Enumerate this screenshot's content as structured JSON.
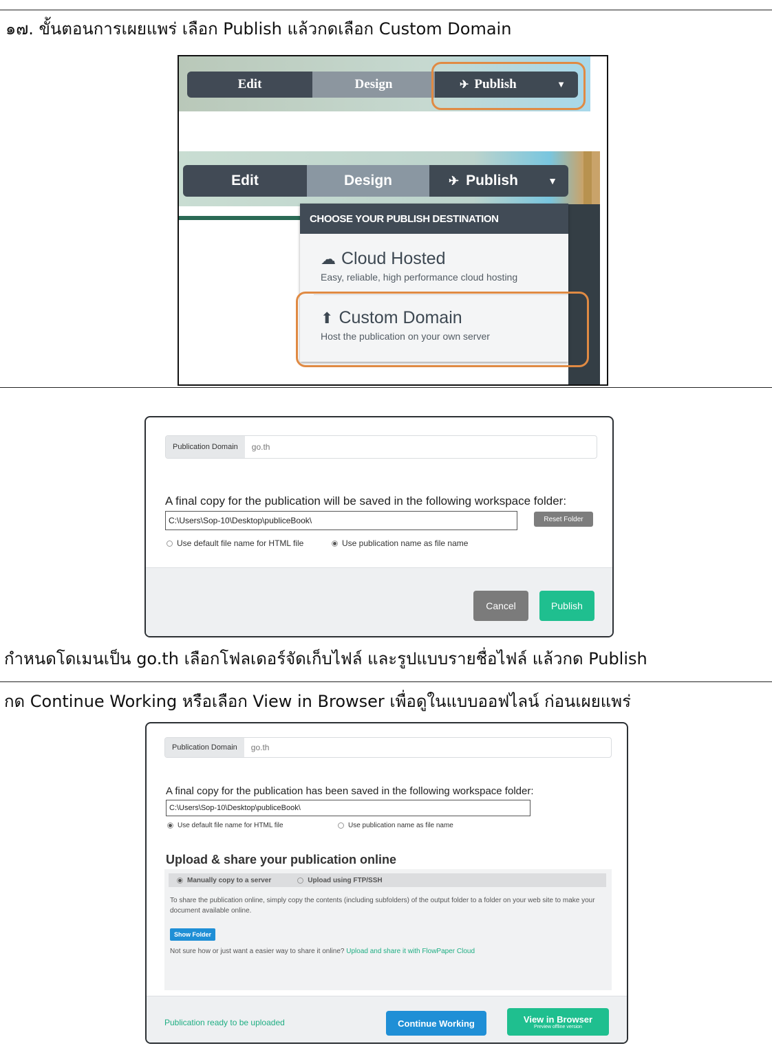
{
  "step17": {
    "heading": "๑๗. ขั้นตอนการเผยแพร่  เลือก Publish แล้วกดเลือก Custom Domain"
  },
  "menu_top": {
    "edit": "Edit",
    "design": "Design",
    "publish": "Publish"
  },
  "menu_bottom": {
    "edit": "Edit",
    "design": "Design",
    "publish": "Publish",
    "dropdown_header": "CHOOSE YOUR PUBLISH DESTINATION",
    "options": [
      {
        "title": "Cloud Hosted",
        "subtitle": "Easy, reliable, high performance cloud hosting",
        "icon": "cloud-icon"
      },
      {
        "title": "Custom Domain",
        "subtitle": "Host the publication on your own server",
        "icon": "upload-icon"
      }
    ]
  },
  "dialog1": {
    "domain_label": "Publication Domain",
    "domain_value": "go.th",
    "folder_text": "A final copy for the publication will be saved in the following workspace folder:",
    "path": "C:\\Users\\Sop-10\\Desktop\\publiceBook\\",
    "reset_folder": "Reset Folder",
    "radio_default": "Use default file name for HTML file",
    "radio_pubname": "Use publication name as file name",
    "cancel": "Cancel",
    "publish": "Publish"
  },
  "caption1": "กำหนดโดเมนเป็น go.th เลือกโฟลเดอร์จัดเก็บไฟล์ และรูปแบบรายชื่อไฟล์ แล้วกด Publish",
  "caption2": "กด Continue Working หรือเลือก View in Browser เพื่อดูในแบบออฟไลน์ ก่อนเผยแพร่",
  "dialog2": {
    "domain_label": "Publication Domain",
    "domain_value": "go.th",
    "folder_text": "A final copy for the publication has been saved in the following workspace folder:",
    "path": "C:\\Users\\Sop-10\\Desktop\\publiceBook\\",
    "radio_default": "Use default file name for HTML file",
    "radio_pubname": "Use publication name as file name",
    "upload_heading": "Upload & share your publication online",
    "tab_manual": "Manually copy to a server",
    "tab_ftp": "Upload using FTP/SSH",
    "share_text": "To share the publication online, simply copy the contents (including subfolders) of the output folder to a folder on your web site to make your document available online.",
    "show_folder": "Show Folder",
    "not_sure_text": "Not sure how or just want a easier way to share it online?",
    "flowpaper_link": "Upload and share it with FlowPaper Cloud",
    "status": "Publication ready to be uploaded",
    "continue": "Continue Working",
    "view_browser": "View in Browser",
    "view_browser_sub": "Preview offline version"
  },
  "colors": {
    "highlight": "#e08a43",
    "menu_dark": "#414a55",
    "publish_green": "#1fbf8f",
    "continue_blue": "#1f8fd6"
  }
}
